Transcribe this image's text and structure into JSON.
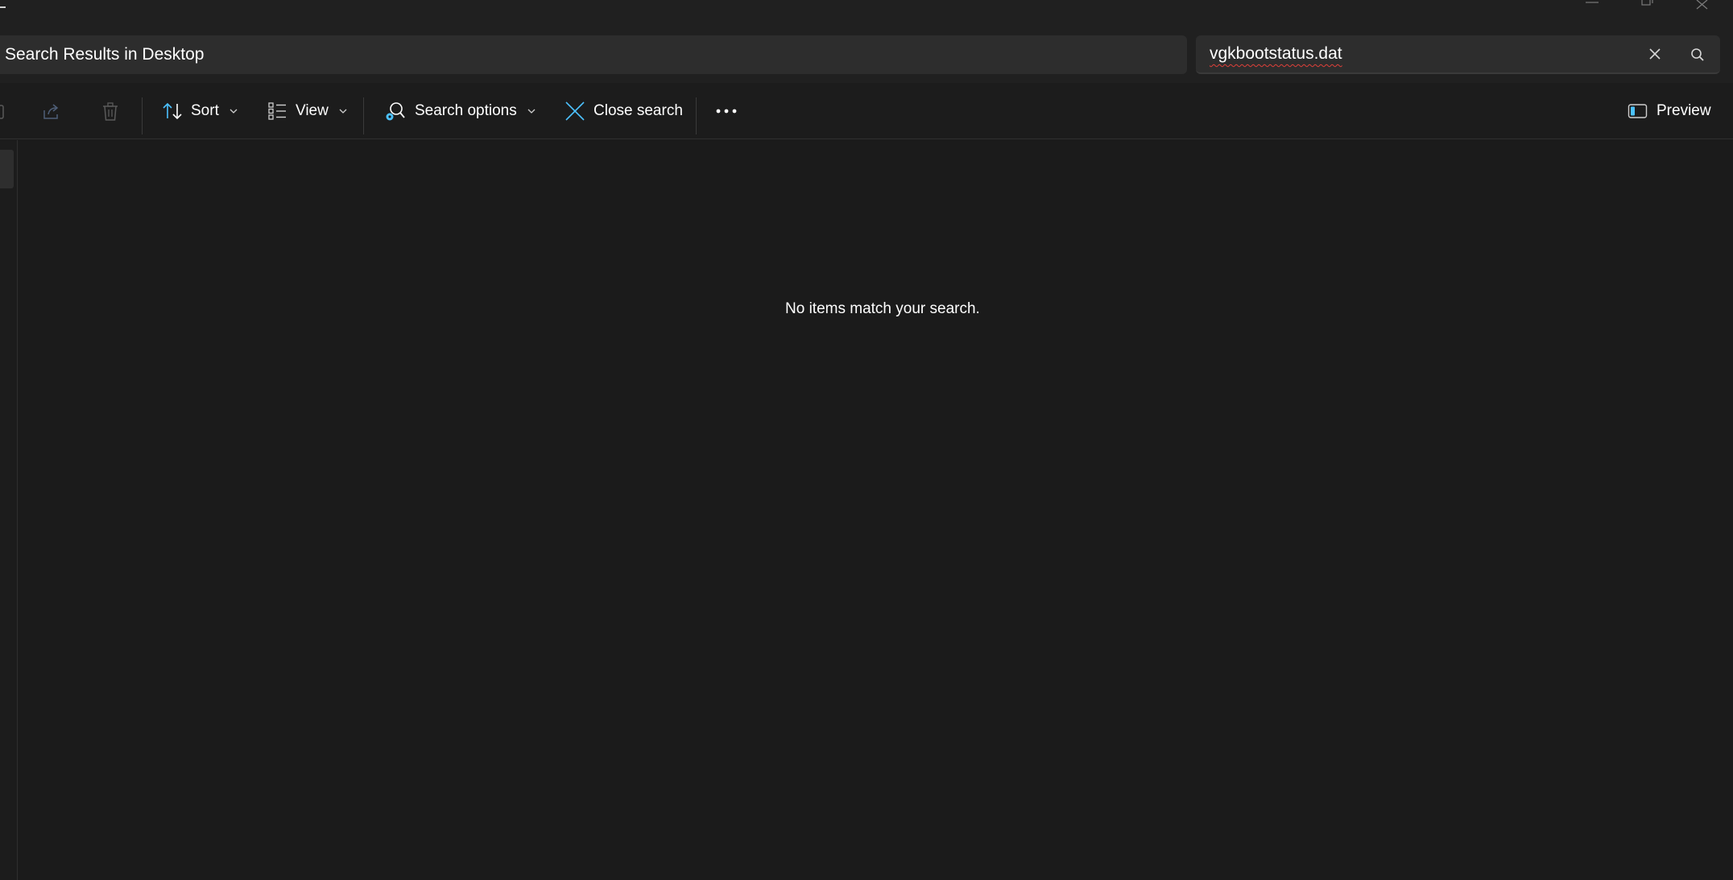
{
  "window": {
    "controls": [
      "minimize-icon",
      "restore-icon",
      "close-icon"
    ]
  },
  "address": {
    "path_text": "Search Results in Desktop"
  },
  "search": {
    "value": "vgkbootstatus.dat",
    "clear_icon": "close-icon",
    "go_icon": "search-icon"
  },
  "toolbar": {
    "share_icon": "share-icon",
    "delete_icon": "trash-icon",
    "sort_label": "Sort",
    "view_label": "View",
    "search_options_label": "Search options",
    "close_search_label": "Close search",
    "more_icon": "more-icon",
    "preview_label": "Preview"
  },
  "content": {
    "empty_message": "No items match your search."
  },
  "colors": {
    "background": "#1c1c1c",
    "titlebar": "#202020",
    "field": "#2d2d2d",
    "accent": "#4cc2ff",
    "spellcheck": "#e0403a"
  }
}
